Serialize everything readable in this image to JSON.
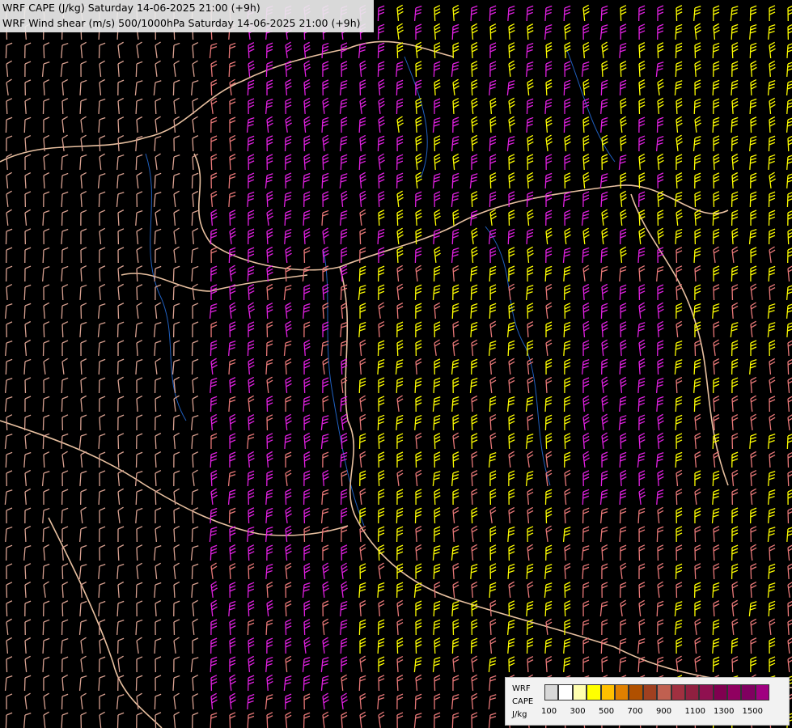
{
  "title": {
    "line1": "WRF CAPE (J/kg) Saturday 14-06-2025 21:00 (+9h)",
    "line2": "WRF Wind shear (m/s) 500/1000hPa Saturday 14-06-2025 21:00 (+9h)"
  },
  "legend": {
    "label_line1": "WRF",
    "label_line2": "CAPE",
    "label_line3": "J/kg",
    "colors": [
      "#d8d8d8",
      "#ffffff",
      "#ffffb0",
      "#ffff00",
      "#ffc000",
      "#e08000",
      "#b05000",
      "#a04020",
      "#c06050",
      "#a03040",
      "#902040",
      "#901050",
      "#800050",
      "#900060",
      "#800060",
      "#a00080"
    ],
    "ticks": [
      "100",
      "300",
      "500",
      "700",
      "900",
      "1100",
      "1300",
      "1500"
    ]
  },
  "map": {
    "field_colors": {
      "cape_low": "#d8a090",
      "cape_mid": "#e87878",
      "cape_high": "#e020e0",
      "cape_vhigh": "#ffff00",
      "border": "#e8c0a0",
      "river": "#2060c0"
    }
  }
}
